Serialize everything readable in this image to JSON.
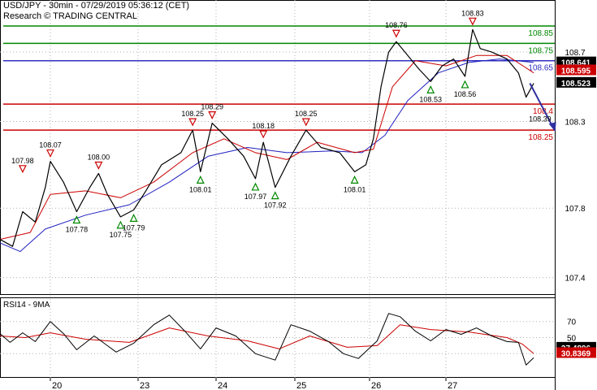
{
  "header": {
    "line1": "USD/JPY - 30min - 07/29/2019 05:36:12 (CET)",
    "line2": "Research © TRADING CENTRAL"
  },
  "colors": {
    "price": "#000000",
    "ma_fast": "#cc0000",
    "ma_slow": "#2020c0",
    "resistance": "#008800",
    "pivot": "#3030c0",
    "support": "#cc0000",
    "badge_dark": "#000000",
    "badge_red": "#cc0000",
    "marker_down": "#cc0000",
    "marker_up": "#008800",
    "forecast_arrow": "#3030a0",
    "grid": "#b0b0b0"
  },
  "chart_data": {
    "type": "line",
    "price_panel": {
      "symbol": "USD/JPY",
      "timeframe": "30min",
      "ylim": [
        107.3,
        109.0
      ],
      "y_ticks": [
        "108.7",
        "108.3",
        "107.8",
        "107.4"
      ],
      "x_ticks": [
        "20",
        "23",
        "24",
        "25",
        "26",
        "27"
      ],
      "price_series": [
        {
          "x": 0,
          "y": 107.62
        },
        {
          "x": 0.25,
          "y": 107.58
        },
        {
          "x": 0.45,
          "y": 107.78
        },
        {
          "x": 0.7,
          "y": 107.72
        },
        {
          "x": 0.9,
          "y": 107.92
        },
        {
          "x": 1.0,
          "y": 108.07
        },
        {
          "x": 1.15,
          "y": 107.95
        },
        {
          "x": 1.3,
          "y": 107.78
        },
        {
          "x": 1.45,
          "y": 107.92
        },
        {
          "x": 1.55,
          "y": 108.0
        },
        {
          "x": 1.65,
          "y": 107.88
        },
        {
          "x": 1.8,
          "y": 107.75
        },
        {
          "x": 1.95,
          "y": 107.79
        },
        {
          "x": 2.1,
          "y": 107.9
        },
        {
          "x": 2.3,
          "y": 108.05
        },
        {
          "x": 2.55,
          "y": 108.12
        },
        {
          "x": 2.7,
          "y": 108.25
        },
        {
          "x": 2.8,
          "y": 108.01
        },
        {
          "x": 2.95,
          "y": 108.29
        },
        {
          "x": 3.15,
          "y": 108.2
        },
        {
          "x": 3.35,
          "y": 108.1
        },
        {
          "x": 3.5,
          "y": 107.97
        },
        {
          "x": 3.6,
          "y": 108.18
        },
        {
          "x": 3.75,
          "y": 107.92
        },
        {
          "x": 3.95,
          "y": 108.1
        },
        {
          "x": 4.15,
          "y": 108.25
        },
        {
          "x": 4.35,
          "y": 108.15
        },
        {
          "x": 4.6,
          "y": 108.12
        },
        {
          "x": 4.8,
          "y": 108.01
        },
        {
          "x": 4.95,
          "y": 108.05
        },
        {
          "x": 5.05,
          "y": 108.2
        },
        {
          "x": 5.15,
          "y": 108.5
        },
        {
          "x": 5.25,
          "y": 108.7
        },
        {
          "x": 5.35,
          "y": 108.76
        },
        {
          "x": 5.5,
          "y": 108.68
        },
        {
          "x": 5.65,
          "y": 108.6
        },
        {
          "x": 5.8,
          "y": 108.53
        },
        {
          "x": 5.95,
          "y": 108.62
        },
        {
          "x": 6.1,
          "y": 108.66
        },
        {
          "x": 6.25,
          "y": 108.56
        },
        {
          "x": 6.35,
          "y": 108.83
        },
        {
          "x": 6.45,
          "y": 108.72
        },
        {
          "x": 6.6,
          "y": 108.7
        },
        {
          "x": 6.8,
          "y": 108.66
        },
        {
          "x": 6.95,
          "y": 108.58
        },
        {
          "x": 7.05,
          "y": 108.44
        },
        {
          "x": 7.15,
          "y": 108.52
        }
      ],
      "ma_fast": [
        {
          "x": 0,
          "y": 107.62
        },
        {
          "x": 0.6,
          "y": 107.66
        },
        {
          "x": 1.0,
          "y": 107.88
        },
        {
          "x": 1.4,
          "y": 107.9
        },
        {
          "x": 1.8,
          "y": 107.86
        },
        {
          "x": 2.2,
          "y": 107.95
        },
        {
          "x": 2.7,
          "y": 108.12
        },
        {
          "x": 3.1,
          "y": 108.2
        },
        {
          "x": 3.5,
          "y": 108.12
        },
        {
          "x": 3.9,
          "y": 108.08
        },
        {
          "x": 4.3,
          "y": 108.18
        },
        {
          "x": 4.8,
          "y": 108.12
        },
        {
          "x": 5.05,
          "y": 108.14
        },
        {
          "x": 5.3,
          "y": 108.5
        },
        {
          "x": 5.6,
          "y": 108.65
        },
        {
          "x": 6.0,
          "y": 108.62
        },
        {
          "x": 6.4,
          "y": 108.68
        },
        {
          "x": 6.8,
          "y": 108.68
        },
        {
          "x": 7.15,
          "y": 108.58
        }
      ],
      "ma_slow": [
        {
          "x": 0,
          "y": 107.6
        },
        {
          "x": 0.4,
          "y": 107.55
        },
        {
          "x": 0.9,
          "y": 107.68
        },
        {
          "x": 1.4,
          "y": 107.76
        },
        {
          "x": 1.9,
          "y": 107.82
        },
        {
          "x": 2.4,
          "y": 107.95
        },
        {
          "x": 2.9,
          "y": 108.1
        },
        {
          "x": 3.4,
          "y": 108.15
        },
        {
          "x": 3.9,
          "y": 108.12
        },
        {
          "x": 4.5,
          "y": 108.13
        },
        {
          "x": 4.9,
          "y": 108.12
        },
        {
          "x": 5.2,
          "y": 108.22
        },
        {
          "x": 5.5,
          "y": 108.42
        },
        {
          "x": 5.9,
          "y": 108.58
        },
        {
          "x": 6.3,
          "y": 108.64
        },
        {
          "x": 6.7,
          "y": 108.66
        },
        {
          "x": 7.15,
          "y": 108.64
        }
      ],
      "levels": [
        {
          "value": 108.85,
          "label": "108.85",
          "role": "resistance"
        },
        {
          "value": 108.75,
          "label": "108.75",
          "role": "resistance"
        },
        {
          "value": 108.65,
          "label": "108.65",
          "role": "pivot"
        },
        {
          "value": 108.4,
          "label": "108.4",
          "role": "support"
        },
        {
          "value": 108.25,
          "label": "108.25",
          "role": "support"
        }
      ],
      "price_badges": [
        {
          "value": 108.641,
          "label": "108.641",
          "style": "dark"
        },
        {
          "value": 108.595,
          "label": "108.595",
          "style": "red"
        },
        {
          "value": 108.523,
          "label": "108.523",
          "style": "dark"
        }
      ],
      "markers": [
        {
          "x": 0.45,
          "y": 107.98,
          "label": "107.98",
          "dir": "down"
        },
        {
          "x": 1.0,
          "y": 108.07,
          "label": "108.07",
          "dir": "down"
        },
        {
          "x": 1.55,
          "y": 108.0,
          "label": "108.00",
          "dir": "down"
        },
        {
          "x": 1.3,
          "y": 107.78,
          "label": "107.78",
          "dir": "up"
        },
        {
          "x": 1.8,
          "y": 107.75,
          "label": "107.75",
          "dir": "up"
        },
        {
          "x": 1.95,
          "y": 107.79,
          "label": "107.79",
          "dir": "up"
        },
        {
          "x": 2.7,
          "y": 108.25,
          "label": "108.25",
          "dir": "down"
        },
        {
          "x": 2.95,
          "y": 108.29,
          "label": "108.29",
          "dir": "down"
        },
        {
          "x": 2.8,
          "y": 108.01,
          "label": "108.01",
          "dir": "up"
        },
        {
          "x": 3.6,
          "y": 108.18,
          "label": "108.18",
          "dir": "down"
        },
        {
          "x": 3.5,
          "y": 107.97,
          "label": "107.97",
          "dir": "up"
        },
        {
          "x": 3.75,
          "y": 107.92,
          "label": "107.92",
          "dir": "up"
        },
        {
          "x": 4.15,
          "y": 108.25,
          "label": "108.25",
          "dir": "down"
        },
        {
          "x": 4.8,
          "y": 108.01,
          "label": "108.01",
          "dir": "up"
        },
        {
          "x": 5.35,
          "y": 108.76,
          "label": "108.76",
          "dir": "down"
        },
        {
          "x": 5.8,
          "y": 108.53,
          "label": "108.53",
          "dir": "up"
        },
        {
          "x": 6.35,
          "y": 108.83,
          "label": "108.83",
          "dir": "down"
        },
        {
          "x": 6.25,
          "y": 108.56,
          "label": "108.56",
          "dir": "up"
        }
      ],
      "forecast": {
        "from": {
          "x": 7.1,
          "y": 108.52
        },
        "to": {
          "x": 7.4,
          "y": 108.24
        },
        "label": "108.39"
      }
    },
    "rsi_panel": {
      "title": "RSI14 - 9MA",
      "ylim": [
        0,
        100
      ],
      "y_ticks": [
        "70",
        "50",
        "30"
      ],
      "rsi": [
        {
          "x": 0,
          "y": 55
        },
        {
          "x": 0.2,
          "y": 44
        },
        {
          "x": 0.45,
          "y": 56
        },
        {
          "x": 0.7,
          "y": 45
        },
        {
          "x": 1.0,
          "y": 70
        },
        {
          "x": 1.15,
          "y": 55
        },
        {
          "x": 1.3,
          "y": 35
        },
        {
          "x": 1.5,
          "y": 52
        },
        {
          "x": 1.75,
          "y": 32
        },
        {
          "x": 1.95,
          "y": 43
        },
        {
          "x": 2.2,
          "y": 66
        },
        {
          "x": 2.4,
          "y": 78
        },
        {
          "x": 2.6,
          "y": 58
        },
        {
          "x": 2.8,
          "y": 36
        },
        {
          "x": 3.0,
          "y": 62
        },
        {
          "x": 3.25,
          "y": 52
        },
        {
          "x": 3.5,
          "y": 30
        },
        {
          "x": 3.75,
          "y": 22
        },
        {
          "x": 3.95,
          "y": 66
        },
        {
          "x": 4.2,
          "y": 58
        },
        {
          "x": 4.45,
          "y": 45
        },
        {
          "x": 4.65,
          "y": 30
        },
        {
          "x": 4.85,
          "y": 24
        },
        {
          "x": 5.1,
          "y": 46
        },
        {
          "x": 5.25,
          "y": 80
        },
        {
          "x": 5.4,
          "y": 76
        },
        {
          "x": 5.6,
          "y": 58
        },
        {
          "x": 5.8,
          "y": 46
        },
        {
          "x": 6.0,
          "y": 60
        },
        {
          "x": 6.2,
          "y": 54
        },
        {
          "x": 6.4,
          "y": 62
        },
        {
          "x": 6.6,
          "y": 52
        },
        {
          "x": 6.8,
          "y": 45
        },
        {
          "x": 6.95,
          "y": 44
        },
        {
          "x": 7.05,
          "y": 16
        },
        {
          "x": 7.15,
          "y": 25
        }
      ],
      "rsi_ma": [
        {
          "x": 0,
          "y": 52
        },
        {
          "x": 0.5,
          "y": 50
        },
        {
          "x": 1.0,
          "y": 56
        },
        {
          "x": 1.4,
          "y": 48
        },
        {
          "x": 1.9,
          "y": 44
        },
        {
          "x": 2.4,
          "y": 62
        },
        {
          "x": 2.9,
          "y": 52
        },
        {
          "x": 3.4,
          "y": 46
        },
        {
          "x": 3.8,
          "y": 36
        },
        {
          "x": 4.2,
          "y": 52
        },
        {
          "x": 4.7,
          "y": 38
        },
        {
          "x": 5.1,
          "y": 40
        },
        {
          "x": 5.4,
          "y": 66
        },
        {
          "x": 5.8,
          "y": 60
        },
        {
          "x": 6.3,
          "y": 57
        },
        {
          "x": 6.8,
          "y": 50
        },
        {
          "x": 7.0,
          "y": 42
        },
        {
          "x": 7.15,
          "y": 30
        }
      ],
      "badges": [
        {
          "value": 37.4896,
          "label": "37.4896",
          "style": "dark"
        },
        {
          "value": 30.8369,
          "label": "30.8369",
          "style": "red"
        }
      ]
    }
  }
}
